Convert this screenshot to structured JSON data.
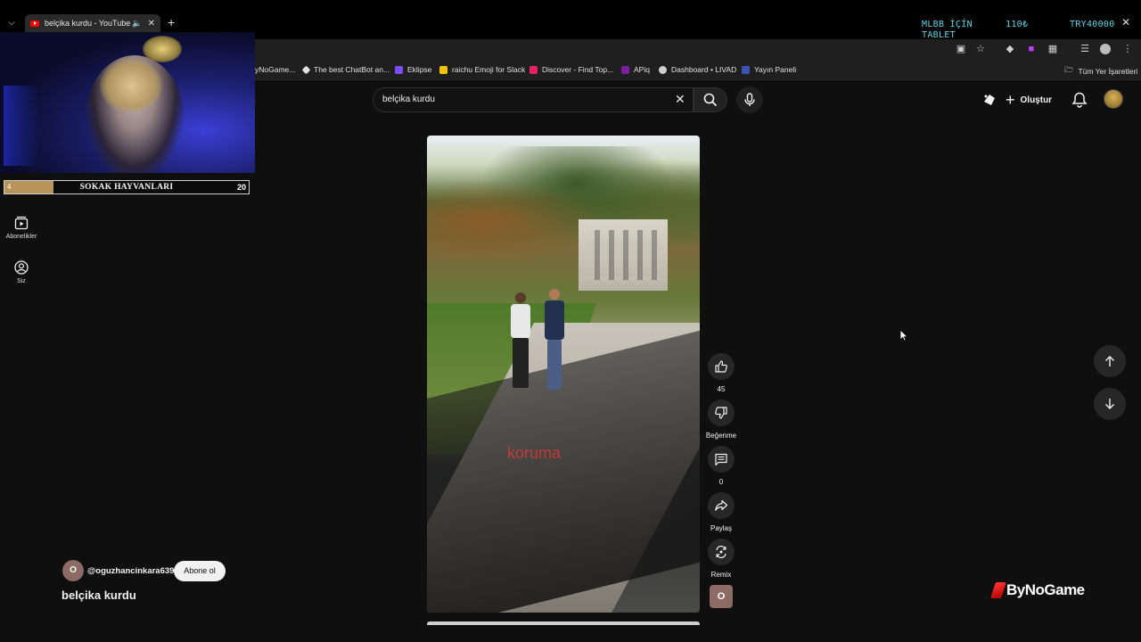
{
  "browser": {
    "tab_title": "belçika kurdu - YouTube",
    "tab_menu_icon": "chevron-down-icon",
    "new_tab_label": "+",
    "overlay": {
      "goal_text": "MLBB İÇİN TABLET",
      "current": "110₺",
      "target": "TRY40000"
    },
    "bookmarks": [
      {
        "label": "yNoGame...",
        "color": "#1f1f1f"
      },
      {
        "label": "The best ChatBot an...",
        "color": "#e0e0e0"
      },
      {
        "label": "Eklipse",
        "color": "#7c4dff"
      },
      {
        "label": "raichu Emoji for Slack",
        "color": "#f2c200"
      },
      {
        "label": "Discover - Find Top...",
        "color": "#e91e63"
      },
      {
        "label": "APiq",
        "color": "#7b1fa2"
      },
      {
        "label": "Dashboard • LIVAD",
        "color": "#cfcfcf"
      },
      {
        "label": "Yayın Paneli",
        "color": "#3f51b5"
      }
    ],
    "all_bookmarks_label": "Tüm Yer İşaretleri"
  },
  "search": {
    "query": "belçika kurdu"
  },
  "header": {
    "create_label": "Oluştur"
  },
  "stream_overlay": {
    "progress_current": "4",
    "progress_label": "SOKAK HAYVANLARI",
    "progress_goal": "20",
    "progress_fraction": 0.2
  },
  "sidebar": {
    "items": [
      {
        "label": "Abonelikler",
        "icon": "subscriptions-icon"
      },
      {
        "label": "Siz",
        "icon": "user-icon"
      }
    ]
  },
  "video": {
    "caption": "koruma"
  },
  "actions": {
    "like_count": "45",
    "dislike_label": "Beğenme",
    "comment_count": "0",
    "share_label": "Paylaş",
    "remix_label": "Remix",
    "channel_initial": "O"
  },
  "channel": {
    "initial": "O",
    "handle": "@oguzhancinkara639",
    "subscribe_label": "Abone ol",
    "video_title": "belçika kurdu"
  },
  "watermark": {
    "text": "ByNoGame"
  },
  "colors": {
    "background": "#0f0f0f",
    "accent": "#ff0000",
    "overlay_cyan": "#5fd4e6"
  }
}
